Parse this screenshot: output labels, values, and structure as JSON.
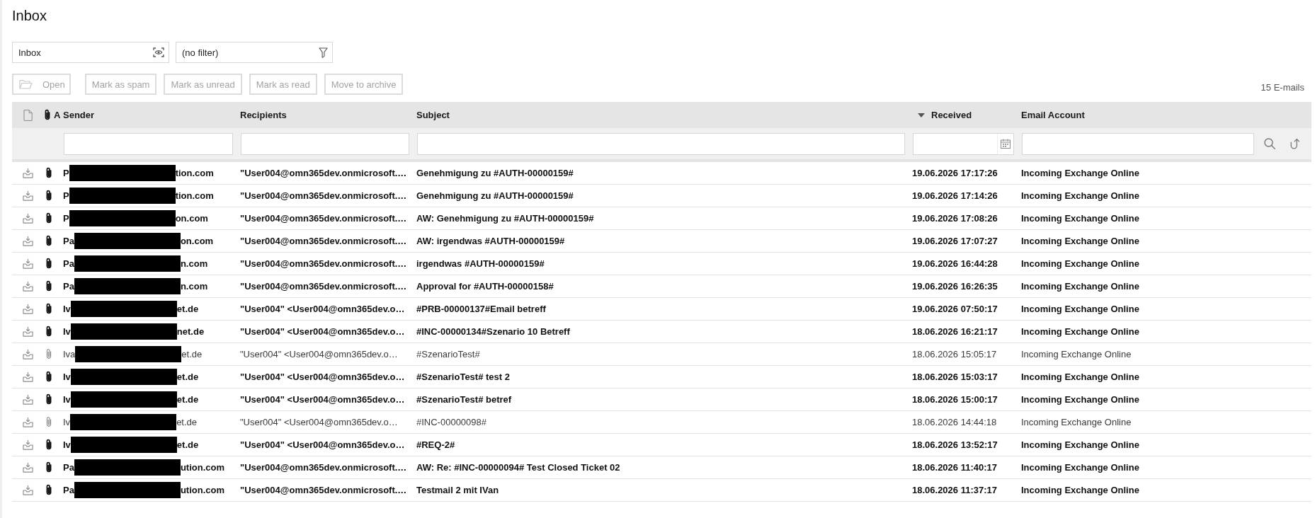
{
  "page": {
    "title": "Inbox"
  },
  "selectors": [
    {
      "kind": "folder",
      "value": "Inbox"
    },
    {
      "kind": "filter",
      "value": "(no filter)"
    }
  ],
  "toolbar": {
    "buttons": [
      {
        "kind": "open",
        "label": "Open",
        "disabled": true
      },
      {
        "kind": "action",
        "label": "Mark as spam",
        "disabled": true
      },
      {
        "kind": "action",
        "label": "Mark as unread",
        "disabled": true
      },
      {
        "kind": "action",
        "label": "Mark as read",
        "disabled": true
      },
      {
        "kind": "action",
        "label": "Move to archive",
        "disabled": true
      }
    ],
    "count": "15 E-mails"
  },
  "table": {
    "columns": [
      {
        "kind": "type"
      },
      {
        "kind": "attachment",
        "label": "A"
      },
      {
        "kind": "text",
        "label": "Sender",
        "sorted": false
      },
      {
        "kind": "text",
        "label": "Recipients",
        "sorted": false
      },
      {
        "kind": "text",
        "label": "Subject",
        "sorted": false
      },
      {
        "kind": "text",
        "label": "Received",
        "sorted": true
      },
      {
        "kind": "text",
        "label": "Email Account",
        "sorted": false
      }
    ],
    "filters": [
      {
        "kind": "empty"
      },
      {
        "kind": "empty"
      },
      {
        "kind": "text"
      },
      {
        "kind": "text"
      },
      {
        "kind": "text"
      },
      {
        "kind": "date"
      },
      {
        "kind": "text"
      }
    ],
    "rows": [
      {
        "unread": true,
        "attachment": true,
        "sender": [
          "P",
          "tion.com"
        ],
        "recipients": "\"User004@omn365dev.onmicrosoft.…",
        "subject": "Genehmigung zu #AUTH-00000159#",
        "received": "19.06.2026 17:17:26",
        "account": "Incoming Exchange Online"
      },
      {
        "unread": true,
        "attachment": true,
        "sender": [
          "P",
          "tion.com"
        ],
        "recipients": "\"User004@omn365dev.onmicrosoft.…",
        "subject": "Genehmigung zu #AUTH-00000159#",
        "received": "19.06.2026 17:14:26",
        "account": "Incoming Exchange Online"
      },
      {
        "unread": true,
        "attachment": true,
        "sender": [
          "P",
          "on.com"
        ],
        "recipients": "\"User004@omn365dev.onmicrosoft.…",
        "subject": "AW: Genehmigung zu #AUTH-00000159#",
        "received": "19.06.2026 17:08:26",
        "account": "Incoming Exchange Online"
      },
      {
        "unread": true,
        "attachment": true,
        "sender": [
          "Pa",
          "on.com"
        ],
        "recipients": "\"User004@omn365dev.onmicrosoft.…",
        "subject": "AW: irgendwas #AUTH-00000159#",
        "received": "19.06.2026 17:07:27",
        "account": "Incoming Exchange Online"
      },
      {
        "unread": true,
        "attachment": true,
        "sender": [
          "Pa",
          "n.com"
        ],
        "recipients": "\"User004@omn365dev.onmicrosoft.…",
        "subject": "irgendwas #AUTH-00000159#",
        "received": "19.06.2026 16:44:28",
        "account": "Incoming Exchange Online"
      },
      {
        "unread": true,
        "attachment": true,
        "sender": [
          "Pa",
          "n.com"
        ],
        "recipients": "\"User004@omn365dev.onmicrosoft.…",
        "subject": "Approval for #AUTH-00000158#",
        "received": "19.06.2026 16:26:35",
        "account": "Incoming Exchange Online"
      },
      {
        "unread": true,
        "attachment": true,
        "sender": [
          "Iv",
          "et.de"
        ],
        "recipients": "\"User004\" <User004@omn365dev.o…",
        "subject": "#PRB-00000137#Email betreff",
        "received": "19.06.2026 07:50:17",
        "account": "Incoming Exchange Online"
      },
      {
        "unread": true,
        "attachment": true,
        "sender": [
          "Iv",
          "net.de"
        ],
        "recipients": "\"User004\" <User004@omn365dev.o…",
        "subject": "#INC-00000134#Szenario 10 Betreff",
        "received": "18.06.2026 16:21:17",
        "account": "Incoming Exchange Online"
      },
      {
        "unread": false,
        "attachment": true,
        "sender": [
          "Iva",
          "et.de"
        ],
        "recipients": "\"User004\" <User004@omn365dev.o…",
        "subject": "#SzenarioTest#",
        "received": "18.06.2026 15:05:17",
        "account": "Incoming Exchange Online"
      },
      {
        "unread": true,
        "attachment": true,
        "sender": [
          "Iv",
          "et.de"
        ],
        "recipients": "\"User004\" <User004@omn365dev.o…",
        "subject": "#SzenarioTest# test 2",
        "received": "18.06.2026 15:03:17",
        "account": "Incoming Exchange Online"
      },
      {
        "unread": true,
        "attachment": true,
        "sender": [
          "Iv",
          "et.de"
        ],
        "recipients": "\"User004\" <User004@omn365dev.o…",
        "subject": "#SzenarioTest# betref",
        "received": "18.06.2026 15:00:17",
        "account": "Incoming Exchange Online"
      },
      {
        "unread": false,
        "attachment": true,
        "sender": [
          "Iv",
          "et.de"
        ],
        "recipients": "\"User004\" <User004@omn365dev.o…",
        "subject": "#INC-00000098#",
        "received": "18.06.2026 14:44:18",
        "account": "Incoming Exchange Online"
      },
      {
        "unread": true,
        "attachment": true,
        "sender": [
          "Iv",
          "et.de"
        ],
        "recipients": "\"User004\" <User004@omn365dev.o…",
        "subject": "#REQ-2#",
        "received": "18.06.2026 13:52:17",
        "account": "Incoming Exchange Online"
      },
      {
        "unread": true,
        "attachment": true,
        "sender": [
          "Pa",
          "ution.com"
        ],
        "recipients": "\"User004@omn365dev.onmicrosoft.…",
        "subject": "AW: Re: #INC-00000094# Test Closed Ticket 02",
        "received": "18.06.2026 11:40:17",
        "account": "Incoming Exchange Online"
      },
      {
        "unread": true,
        "attachment": true,
        "sender": [
          "Pa",
          "ution.com"
        ],
        "recipients": "\"User004@omn365dev.onmicrosoft.…",
        "subject": "Testmail 2 mit IVan",
        "received": "18.06.2026 11:37:17",
        "account": "Incoming Exchange Online"
      }
    ]
  }
}
